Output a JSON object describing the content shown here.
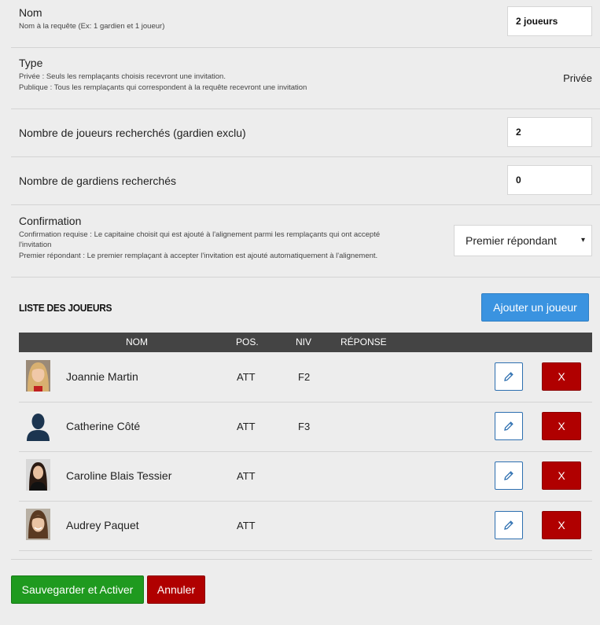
{
  "form": {
    "nom": {
      "label": "Nom",
      "help": "Nom à la requête (Ex: 1 gardien et 1 joueur)",
      "value": "2 joueurs"
    },
    "type": {
      "label": "Type",
      "help_line1": "Privée : Seuls les remplaçants choisis recevront une invitation.",
      "help_line2": "Publique : Tous les remplaçants qui correspondent à la requête recevront une invitation",
      "value": "Privée"
    },
    "nb_joueurs": {
      "label": "Nombre de joueurs recherchés (gardien exclu)",
      "value": "2"
    },
    "nb_gardiens": {
      "label": "Nombre de gardiens recherchés",
      "value": "0"
    },
    "confirmation": {
      "label": "Confirmation",
      "help_line1": "Confirmation requise : Le capitaine choisit qui est ajouté à l'alignement parmi les remplaçants qui ont accepté",
      "help_line1b": "l'invitation",
      "help_line2": "Premier répondant : Le premier remplaçant à accepter l'invitation est ajouté automatiquement à l'alignement.",
      "selected": "Premier répondant",
      "caret": "▾"
    }
  },
  "players_section": {
    "title": "LISTE DES JOUEURS",
    "add_button": "Ajouter un joueur",
    "columns": {
      "nom": "NOM",
      "pos": "POS.",
      "niv": "NIV",
      "reponse": "RÉPONSE"
    },
    "rows": [
      {
        "name": "Joannie Martin",
        "pos": "ATT",
        "niv": "F2",
        "avatar": "photo-blonde",
        "delete_label": "X"
      },
      {
        "name": "Catherine Côté",
        "pos": "ATT",
        "niv": "F3",
        "avatar": "silhouette",
        "delete_label": "X"
      },
      {
        "name": "Caroline Blais Tessier",
        "pos": "ATT",
        "niv": "",
        "avatar": "photo-dark-hair",
        "delete_label": "X"
      },
      {
        "name": "Audrey Paquet",
        "pos": "ATT",
        "niv": "",
        "avatar": "photo-brown-hair",
        "delete_label": "X"
      }
    ]
  },
  "actions": {
    "save": "Sauvegarder et Activer",
    "cancel": "Annuler"
  },
  "colors": {
    "primary": "#3a93e0",
    "success": "#1f9a1f",
    "danger": "#b00000",
    "table_header": "#444444",
    "background": "#ededed"
  }
}
